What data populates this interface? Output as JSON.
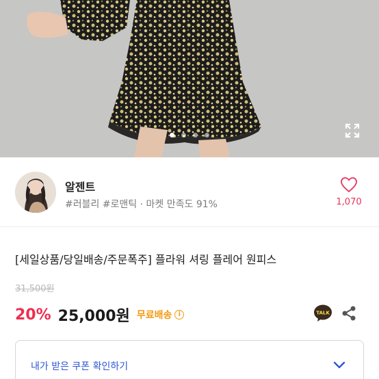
{
  "gallery": {
    "page_count": 4,
    "active_index": 0,
    "expand_icon": "expand-icon"
  },
  "seller": {
    "name": "알젠트",
    "tags": "#러블리 #로맨틱 · 마켓 만족도 91%",
    "like_count": "1,070",
    "like_icon": "heart-icon"
  },
  "product": {
    "title": "[세일상품/당일배송/주문폭주] 플라워 셔링 플레어 원피스",
    "original_price": "31,500원",
    "discount": "20%",
    "price": "25,000원",
    "shipping": "무료배송",
    "talk_label": "TALK"
  },
  "coupon": {
    "label": "내가 받은 쿠폰 확인하기"
  },
  "colors": {
    "accent_red": "#ee2e4f",
    "like_pink": "#e5335c",
    "shipping_orange": "#f29a10",
    "coupon_blue": "#2f55d4"
  }
}
